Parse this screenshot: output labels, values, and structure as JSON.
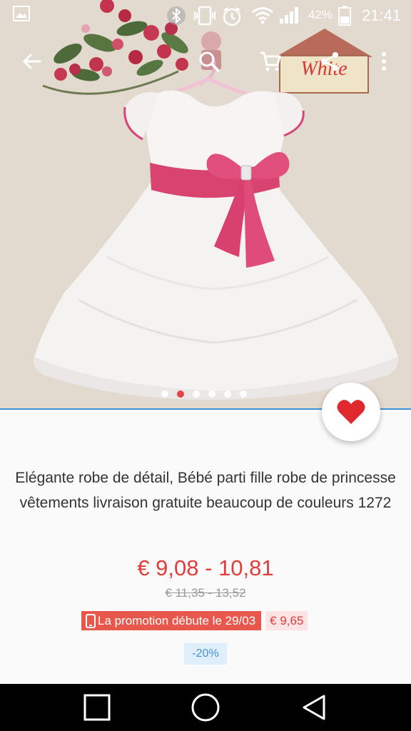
{
  "status_bar": {
    "battery_percent": "42%",
    "time": "21:41",
    "icons": [
      "image-icon",
      "bluetooth-icon",
      "vibrate-icon",
      "alarm-icon",
      "wifi-icon",
      "signal-icon",
      "battery-icon"
    ]
  },
  "app_bar": {
    "icons": [
      "back-arrow-icon",
      "search-icon",
      "cart-icon",
      "share-icon",
      "more-vert-icon"
    ]
  },
  "photo": {
    "sign_text": "White"
  },
  "carousel": {
    "count": 6,
    "active_index": 1
  },
  "product": {
    "title": "Elégante robe de détail, Bébé parti fille robe de princesse vêtements livraison gratuite beaucoup de couleurs 1272",
    "price_range": "€ 9,08 - 10,81",
    "old_price": "€ 11,35 - 13,52",
    "promo_text": "La promotion débute le 29/03",
    "promo_price": "€ 9,65",
    "discount": "-20%"
  },
  "nav_bar": {
    "icons": [
      "recent-apps-icon",
      "home-icon",
      "back-icon"
    ]
  },
  "colors": {
    "price": "#e23b3b",
    "promo_bg": "#e8574c",
    "accent_line": "#3d8fd6",
    "heart": "#e0282f",
    "discount_text": "#4a90d9"
  }
}
